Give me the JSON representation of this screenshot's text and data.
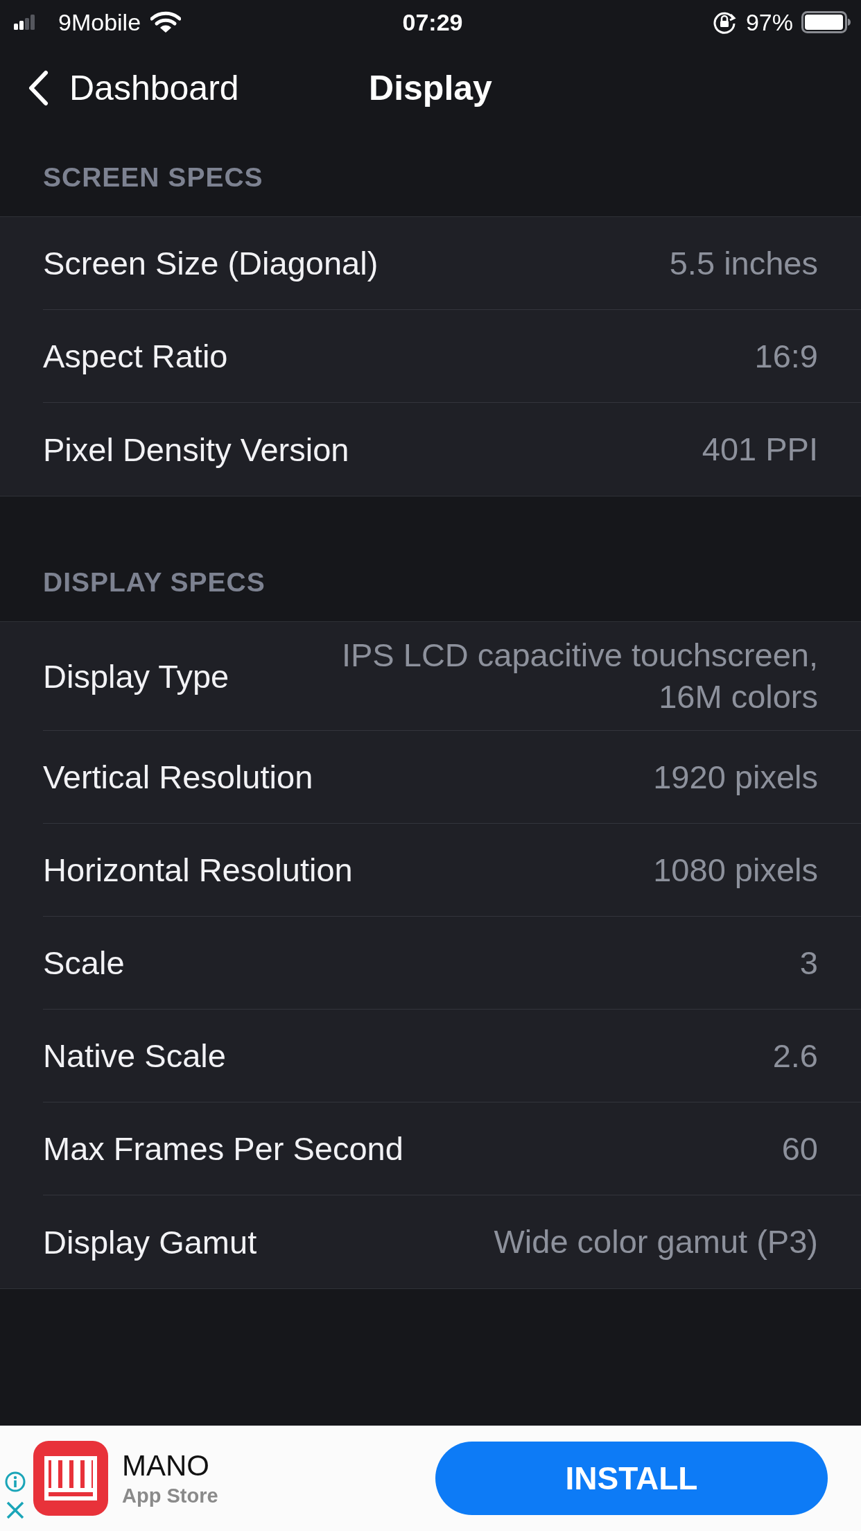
{
  "status_bar": {
    "carrier": "9Mobile",
    "time": "07:29",
    "battery": "97%"
  },
  "nav": {
    "back_label": "Dashboard",
    "title": "Display"
  },
  "sections": [
    {
      "header": "SCREEN SPECS",
      "rows": [
        {
          "label": "Screen Size (Diagonal)",
          "value": "5.5 inches"
        },
        {
          "label": "Aspect Ratio",
          "value": "16:9"
        },
        {
          "label": "Pixel Density Version",
          "value": "401 PPI"
        }
      ]
    },
    {
      "header": "DISPLAY SPECS",
      "rows": [
        {
          "label": "Display Type",
          "value": "IPS LCD capacitive touchscreen, 16M colors"
        },
        {
          "label": "Vertical Resolution",
          "value": "1920 pixels"
        },
        {
          "label": "Horizontal Resolution",
          "value": "1080 pixels"
        },
        {
          "label": "Scale",
          "value": "3"
        },
        {
          "label": "Native Scale",
          "value": "2.6"
        },
        {
          "label": "Max Frames Per Second",
          "value": "60"
        },
        {
          "label": "Display Gamut",
          "value": "Wide color gamut (P3)"
        }
      ]
    }
  ],
  "ad": {
    "app_name": "MANO",
    "store": "App Store",
    "button": "INSTALL"
  }
}
